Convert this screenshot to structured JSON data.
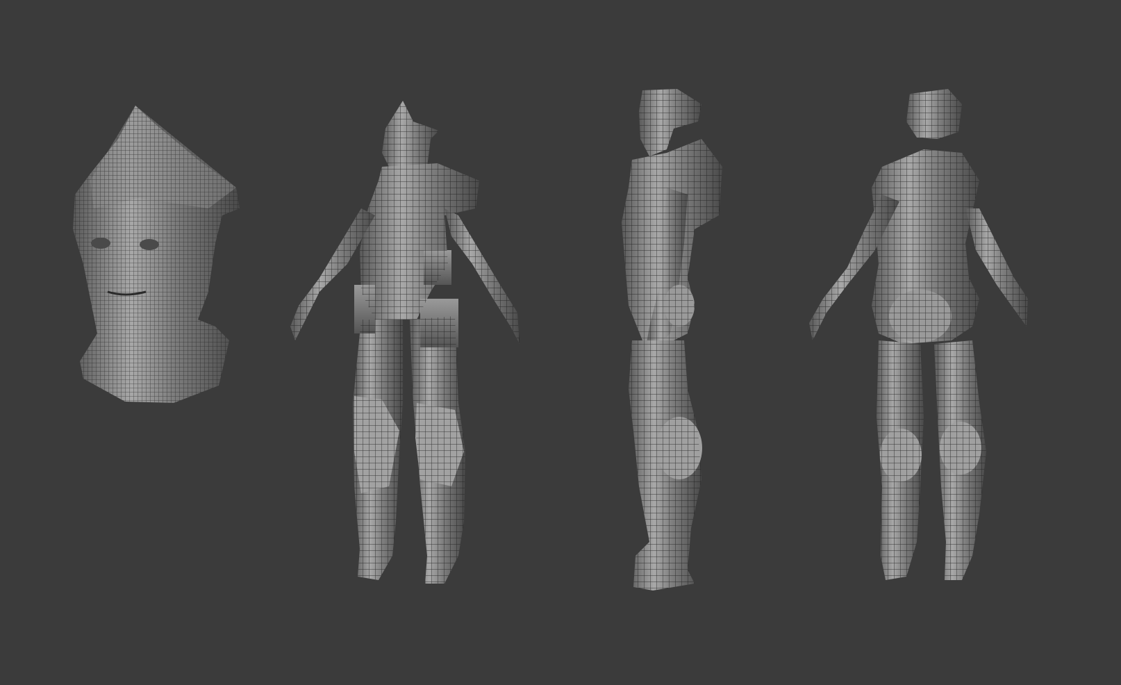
{
  "scene": {
    "background_color": "#3b3b3b",
    "model_color": "#8a8a8a",
    "wire_color": "#1c1c1c",
    "views": [
      {
        "name": "head-closeup",
        "label": ""
      },
      {
        "name": "front-view",
        "label": ""
      },
      {
        "name": "side-view",
        "label": ""
      },
      {
        "name": "back-view",
        "label": ""
      }
    ]
  }
}
